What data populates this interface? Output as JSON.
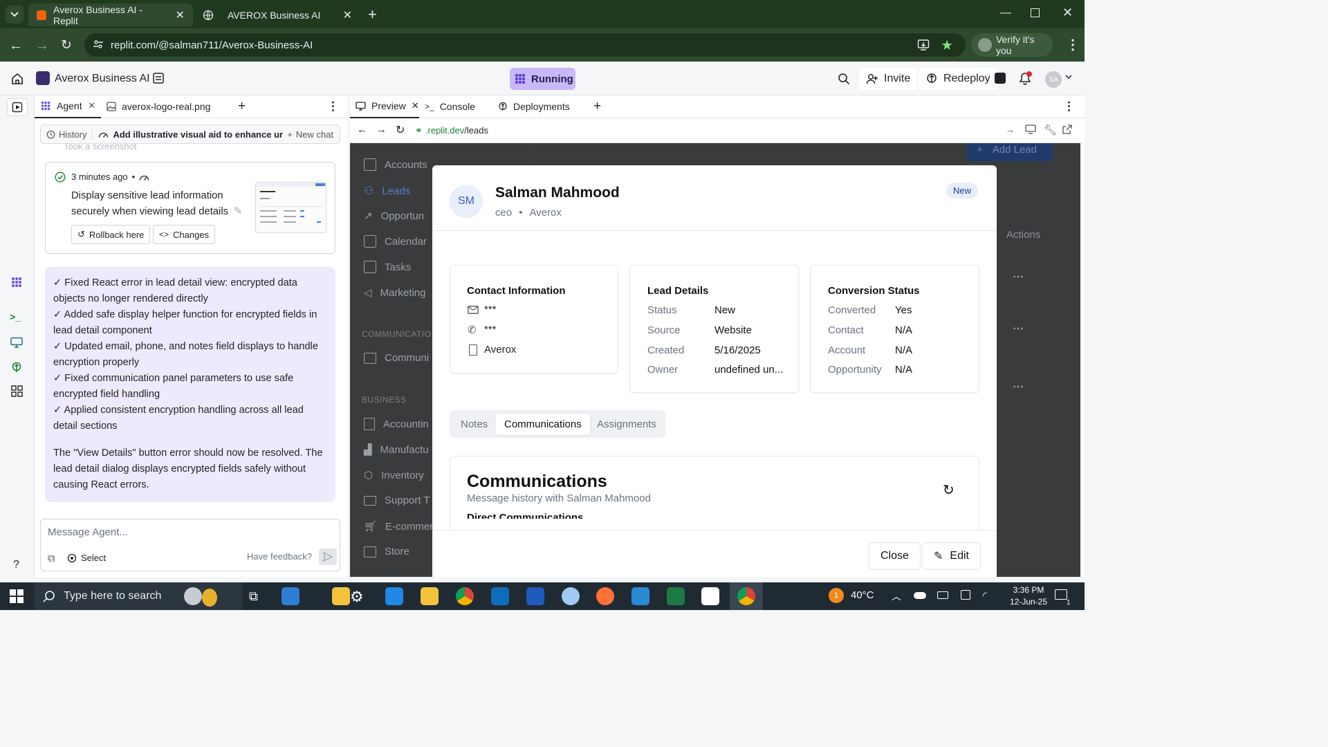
{
  "browser": {
    "tabs": [
      {
        "title": "Averox Business AI - Replit",
        "active": true
      },
      {
        "title": "AVEROX Business AI",
        "active": false
      }
    ],
    "url": "replit.com/@salman711/Averox-Business-AI",
    "verify_label": "Verify it's you"
  },
  "replit": {
    "project_name": "Averox Business AI",
    "status": "Running",
    "invite_label": "Invite",
    "redeploy_label": "Redeploy",
    "avatar_initials": "SA"
  },
  "agent_panel": {
    "tabs": [
      {
        "label": "Agent"
      },
      {
        "label": "averox-logo-real.png"
      }
    ],
    "history_label": "History",
    "chat_title": "Add illustrative visual aid to enhance unde...",
    "new_chat_label": "New chat",
    "faded_text": "Took a screenshot",
    "checkpoint": {
      "time": "3 minutes ago",
      "bullet": "•",
      "description_line1": "Display sensitive lead information",
      "description_line2": "securely when viewing lead details",
      "rollback_label": "Rollback here",
      "changes_label": "Changes"
    },
    "message": {
      "lines": [
        "✓ Fixed React error in lead detail view: encrypted data objects no longer rendered directly",
        "✓ Added safe display helper function for encrypted fields in lead detail component",
        "✓ Updated email, phone, and notes field displays to handle encryption properly",
        "✓ Fixed communication panel parameters to use safe encrypted field handling",
        "✓ Applied consistent encryption handling across all lead detail sections"
      ],
      "summary": "The \"View Details\" button error should now be resolved. The lead detail dialog displays encrypted fields safely without causing React errors."
    },
    "input_placeholder": "Message Agent...",
    "select_label": "Select",
    "feedback_label": "Have feedback?"
  },
  "preview_panel": {
    "tabs": [
      {
        "label": "Preview"
      },
      {
        "label": "Console"
      },
      {
        "label": "Deployments"
      }
    ],
    "url_domain": ".replit.dev",
    "url_path": "/leads"
  },
  "app": {
    "add_lead_label": "Add Lead",
    "actions_header": "Actions",
    "nav": [
      {
        "label": "Accounts",
        "active": false
      },
      {
        "label": "Leads",
        "active": true
      },
      {
        "label": "Opportun",
        "active": false
      },
      {
        "label": "Calendar",
        "active": false
      },
      {
        "label": "Tasks",
        "active": false
      },
      {
        "label": "Marketing",
        "active": false
      }
    ],
    "section_communication": "COMMUNICATIO",
    "nav_comm": [
      {
        "label": "Communi"
      }
    ],
    "section_business": "BUSINESS",
    "nav_business": [
      {
        "label": "Accountin"
      },
      {
        "label": "Manufactu"
      },
      {
        "label": "Inventory"
      },
      {
        "label": "Support T"
      },
      {
        "label": "E-commer"
      },
      {
        "label": "Store"
      }
    ]
  },
  "lead_dialog": {
    "initials": "SM",
    "name": "Salman Mahmood",
    "title": "ceo",
    "separator": "•",
    "company": "Averox",
    "status_badge": "New",
    "contact": {
      "heading": "Contact Information",
      "email": "***",
      "phone": "***",
      "company": "Averox"
    },
    "details": {
      "heading": "Lead Details",
      "rows": [
        {
          "key": "Status",
          "value": "New"
        },
        {
          "key": "Source",
          "value": "Website"
        },
        {
          "key": "Created",
          "value": "5/16/2025"
        },
        {
          "key": "Owner",
          "value": "undefined un..."
        }
      ]
    },
    "conversion": {
      "heading": "Conversion Status",
      "rows": [
        {
          "key": "Converted",
          "value": "Yes"
        },
        {
          "key": "Contact",
          "value": "N/A"
        },
        {
          "key": "Account",
          "value": "N/A"
        },
        {
          "key": "Opportunity",
          "value": "N/A"
        }
      ]
    },
    "tabs": [
      {
        "label": "Notes",
        "active": false
      },
      {
        "label": "Communications",
        "active": true
      },
      {
        "label": "Assignments",
        "active": false
      }
    ],
    "comm_title": "Communications",
    "comm_subtitle": "Message history with Salman Mahmood",
    "comm_section": "Direct Communications",
    "close_label": "Close",
    "edit_label": "Edit"
  },
  "taskbar": {
    "search_placeholder": "Type here to search",
    "temperature": "40°C",
    "time": "3:36 PM",
    "date": "12-Jun-25",
    "notification_count": "1"
  },
  "colors": {
    "chrome_dark": "#1f3a1f",
    "chrome_toolbar": "#2f4a2f",
    "running_bg": "#c8b8f8",
    "agent_message_bg": "#efe9fd",
    "link_green": "#1a7f37",
    "dialog_overlay": "#3a3b3d"
  }
}
